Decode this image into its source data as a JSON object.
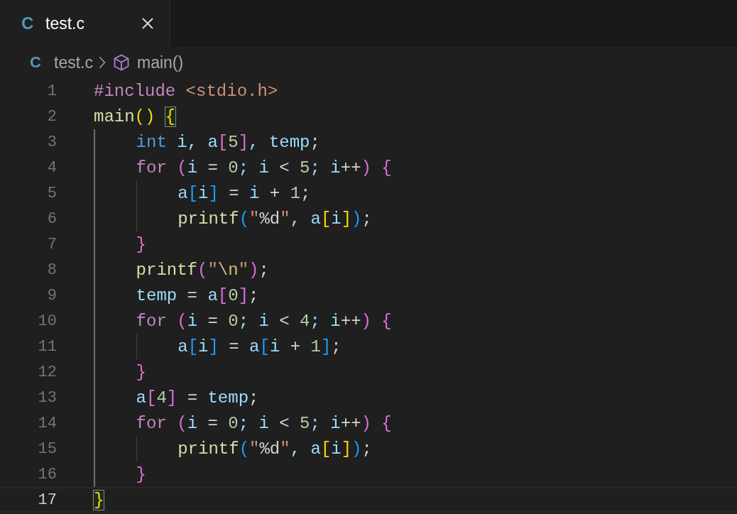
{
  "tabs": [
    {
      "icon_letter": "C",
      "label": "test.c",
      "selected": true
    }
  ],
  "breadcrumb": [
    {
      "icon_letter": "C",
      "label": "test.c",
      "kind": "file"
    },
    {
      "label": "main()",
      "kind": "symbol"
    }
  ],
  "code_lines": [
    {
      "number": "1",
      "current": false,
      "tokens": [
        {
          "text": "#include",
          "kind": "pre"
        },
        {
          "text": " <stdio.h>",
          "kind": "inc"
        }
      ]
    },
    {
      "number": "2",
      "current": false,
      "tokens": [
        {
          "text": "main",
          "kind": "fn"
        },
        {
          "text": "(",
          "kind": "b1"
        },
        {
          "text": ")",
          "kind": "b1"
        },
        {
          "text": " {",
          "kind": "b1",
          "matched": true
        }
      ]
    },
    {
      "number": "3",
      "current": false,
      "tokens": [
        {
          "text": "    int",
          "kind": "type"
        },
        {
          "text": " i",
          "kind": "var"
        },
        {
          "text": ", a",
          "kind": "var"
        },
        {
          "text": "[",
          "kind": "b2"
        },
        {
          "text": "5",
          "kind": "num"
        },
        {
          "text": "]",
          "kind": "b2"
        },
        {
          "text": ", temp",
          "kind": "var"
        },
        {
          "text": ";",
          "kind": "op"
        }
      ]
    },
    {
      "number": "4",
      "current": false,
      "tokens": [
        {
          "text": "    for",
          "kind": "ctrl"
        },
        {
          "text": " (",
          "kind": "b2"
        },
        {
          "text": "i",
          "kind": "var"
        },
        {
          "text": " = ",
          "kind": "op"
        },
        {
          "text": "0",
          "kind": "num"
        },
        {
          "text": "; i",
          "kind": "var"
        },
        {
          "text": " < ",
          "kind": "op"
        },
        {
          "text": "5",
          "kind": "num"
        },
        {
          "text": "; i",
          "kind": "var"
        },
        {
          "text": "++",
          "kind": "op"
        },
        {
          "text": ")",
          "kind": "b2"
        },
        {
          "text": " {",
          "kind": "b2"
        }
      ]
    },
    {
      "number": "5",
      "current": false,
      "tokens": [
        {
          "text": "        a",
          "kind": "var"
        },
        {
          "text": "[",
          "kind": "b3"
        },
        {
          "text": "i",
          "kind": "var"
        },
        {
          "text": "]",
          "kind": "b3"
        },
        {
          "text": " = ",
          "kind": "op"
        },
        {
          "text": "i",
          "kind": "var"
        },
        {
          "text": " + ",
          "kind": "op"
        },
        {
          "text": "1",
          "kind": "num"
        },
        {
          "text": ";",
          "kind": "op"
        }
      ]
    },
    {
      "number": "6",
      "current": false,
      "tokens": [
        {
          "text": "        printf",
          "kind": "fn"
        },
        {
          "text": "(",
          "kind": "b3"
        },
        {
          "text": "\"",
          "kind": "str"
        },
        {
          "text": "%d",
          "kind": "fmt"
        },
        {
          "text": "\"",
          "kind": "str"
        },
        {
          "text": ", a",
          "kind": "var"
        },
        {
          "text": "[",
          "kind": "b1"
        },
        {
          "text": "i",
          "kind": "var"
        },
        {
          "text": "]",
          "kind": "b1"
        },
        {
          "text": ")",
          "kind": "b3"
        },
        {
          "text": ";",
          "kind": "op"
        }
      ]
    },
    {
      "number": "7",
      "current": false,
      "tokens": [
        {
          "text": "    }",
          "kind": "b2"
        }
      ]
    },
    {
      "number": "8",
      "current": false,
      "tokens": [
        {
          "text": "    printf",
          "kind": "fn"
        },
        {
          "text": "(",
          "kind": "b2"
        },
        {
          "text": "\"",
          "kind": "str"
        },
        {
          "text": "\\n",
          "kind": "esc"
        },
        {
          "text": "\"",
          "kind": "str"
        },
        {
          "text": ")",
          "kind": "b2"
        },
        {
          "text": ";",
          "kind": "op"
        }
      ]
    },
    {
      "number": "9",
      "current": false,
      "tokens": [
        {
          "text": "    temp",
          "kind": "var"
        },
        {
          "text": " = ",
          "kind": "op"
        },
        {
          "text": "a",
          "kind": "var"
        },
        {
          "text": "[",
          "kind": "b2"
        },
        {
          "text": "0",
          "kind": "num"
        },
        {
          "text": "]",
          "kind": "b2"
        },
        {
          "text": ";",
          "kind": "op"
        }
      ]
    },
    {
      "number": "10",
      "current": false,
      "tokens": [
        {
          "text": "    for",
          "kind": "ctrl"
        },
        {
          "text": " (",
          "kind": "b2"
        },
        {
          "text": "i",
          "kind": "var"
        },
        {
          "text": " = ",
          "kind": "op"
        },
        {
          "text": "0",
          "kind": "num"
        },
        {
          "text": "; i",
          "kind": "var"
        },
        {
          "text": " < ",
          "kind": "op"
        },
        {
          "text": "4",
          "kind": "num"
        },
        {
          "text": "; i",
          "kind": "var"
        },
        {
          "text": "++",
          "kind": "op"
        },
        {
          "text": ")",
          "kind": "b2"
        },
        {
          "text": " {",
          "kind": "b2"
        }
      ]
    },
    {
      "number": "11",
      "current": false,
      "tokens": [
        {
          "text": "        a",
          "kind": "var"
        },
        {
          "text": "[",
          "kind": "b3"
        },
        {
          "text": "i",
          "kind": "var"
        },
        {
          "text": "]",
          "kind": "b3"
        },
        {
          "text": " = ",
          "kind": "op"
        },
        {
          "text": "a",
          "kind": "var"
        },
        {
          "text": "[",
          "kind": "b3"
        },
        {
          "text": "i",
          "kind": "var"
        },
        {
          "text": " + ",
          "kind": "op"
        },
        {
          "text": "1",
          "kind": "num"
        },
        {
          "text": "]",
          "kind": "b3"
        },
        {
          "text": ";",
          "kind": "op"
        }
      ]
    },
    {
      "number": "12",
      "current": false,
      "tokens": [
        {
          "text": "    }",
          "kind": "b2"
        }
      ]
    },
    {
      "number": "13",
      "current": false,
      "tokens": [
        {
          "text": "    a",
          "kind": "var"
        },
        {
          "text": "[",
          "kind": "b2"
        },
        {
          "text": "4",
          "kind": "num"
        },
        {
          "text": "]",
          "kind": "b2"
        },
        {
          "text": " = ",
          "kind": "op"
        },
        {
          "text": "temp",
          "kind": "var"
        },
        {
          "text": ";",
          "kind": "op"
        }
      ]
    },
    {
      "number": "14",
      "current": false,
      "tokens": [
        {
          "text": "    for",
          "kind": "ctrl"
        },
        {
          "text": " (",
          "kind": "b2"
        },
        {
          "text": "i",
          "kind": "var"
        },
        {
          "text": " = ",
          "kind": "op"
        },
        {
          "text": "0",
          "kind": "num"
        },
        {
          "text": "; i",
          "kind": "var"
        },
        {
          "text": " < ",
          "kind": "op"
        },
        {
          "text": "5",
          "kind": "num"
        },
        {
          "text": "; i",
          "kind": "var"
        },
        {
          "text": "++",
          "kind": "op"
        },
        {
          "text": ")",
          "kind": "b2"
        },
        {
          "text": " {",
          "kind": "b2"
        }
      ]
    },
    {
      "number": "15",
      "current": false,
      "tokens": [
        {
          "text": "        printf",
          "kind": "fn"
        },
        {
          "text": "(",
          "kind": "b3"
        },
        {
          "text": "\"",
          "kind": "str"
        },
        {
          "text": "%d",
          "kind": "fmt"
        },
        {
          "text": "\"",
          "kind": "str"
        },
        {
          "text": ", a",
          "kind": "var"
        },
        {
          "text": "[",
          "kind": "b1"
        },
        {
          "text": "i",
          "kind": "var"
        },
        {
          "text": "]",
          "kind": "b1"
        },
        {
          "text": ")",
          "kind": "b3"
        },
        {
          "text": ";",
          "kind": "op"
        }
      ]
    },
    {
      "number": "16",
      "current": false,
      "tokens": [
        {
          "text": "    }",
          "kind": "b2"
        }
      ]
    },
    {
      "number": "17",
      "current": true,
      "tokens": [
        {
          "text": "}",
          "kind": "b1",
          "matched": true
        }
      ]
    }
  ]
}
